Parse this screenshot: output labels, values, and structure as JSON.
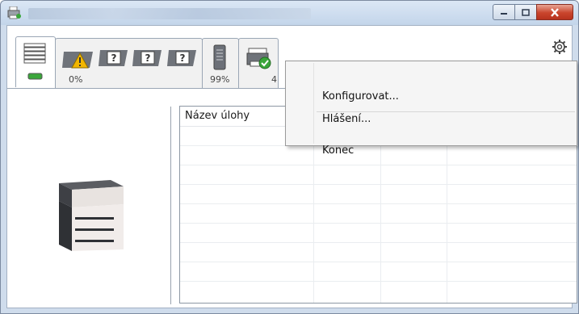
{
  "window": {
    "caption_buttons": [
      "minimize",
      "maximize",
      "close"
    ]
  },
  "tabs": [
    {
      "id": "toner",
      "label": "",
      "icons": [
        "toner-stack-icon",
        "status-green-led-icon"
      ]
    },
    {
      "id": "paper",
      "label": "0%",
      "icons": [
        "paper-tray-warning-icon",
        "paper-unknown-icon",
        "paper-unknown-icon",
        "paper-unknown-icon"
      ]
    },
    {
      "id": "waste",
      "label": "99%",
      "icons": [
        "waste-toner-icon"
      ]
    },
    {
      "id": "device",
      "label": "4",
      "icons": [
        "printer-ok-icon"
      ]
    }
  ],
  "table": {
    "columns": [
      "Název úlohy",
      "",
      "",
      ""
    ]
  },
  "context_menu": {
    "items": [
      "Konfigurovat...",
      "Hlášení...",
      "Konec"
    ]
  },
  "colors": {
    "close_button": "#c9452d",
    "status_ok": "#3aa63a",
    "warning": "#f2b600"
  }
}
